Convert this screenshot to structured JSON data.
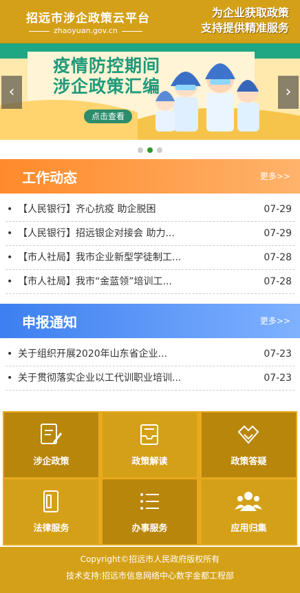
{
  "header": {
    "site_title": "招远市涉企政策云平台",
    "domain": "zhaoyuan.gov.cn",
    "slogan_line1": "为企业获取政策",
    "slogan_line2": "支持提供精准服务"
  },
  "banner": {
    "title_line1": "疫情防控期间",
    "title_line2": "涉企政策汇编",
    "button_label": "点击查看",
    "prev_label": "‹",
    "next_label": "›",
    "active_slide": 2,
    "slide_count": 3
  },
  "work_news": {
    "title": "工作动态",
    "more": "更多>>",
    "items": [
      {
        "title": "【人民银行】齐心抗疫 助企脱困",
        "date": "07-29"
      },
      {
        "title": "【人民银行】招远银企对接会 助力...",
        "date": "07-29"
      },
      {
        "title": "【市人社局】我市企业新型学徒制工...",
        "date": "07-28"
      },
      {
        "title": "【市人社局】我市“金蓝领”培训工...",
        "date": "07-28"
      }
    ]
  },
  "notices": {
    "title": "申报通知",
    "more": "更多>>",
    "items": [
      {
        "title": "关于组织开展2020年山东省企业...",
        "date": "07-23"
      },
      {
        "title": "关于贯彻落实企业以工代训职业培训...",
        "date": "07-23"
      }
    ]
  },
  "tiles": [
    {
      "label": "涉企政策",
      "icon": "policy-edit-icon",
      "color": "#b8860b"
    },
    {
      "label": "政策解读",
      "icon": "inbox-tray-icon",
      "color": "#d4a017"
    },
    {
      "label": "政策答疑",
      "icon": "handshake-icon",
      "color": "#b8860b"
    },
    {
      "label": "法律服务",
      "icon": "legal-document-icon",
      "color": "#d4a017"
    },
    {
      "label": "办事服务",
      "icon": "list-icon",
      "color": "#b8860b"
    },
    {
      "label": "应用归集",
      "icon": "group-users-icon",
      "color": "#d4a017"
    }
  ],
  "footer": {
    "copyright": "Copyright©招远市人民政府版权所有",
    "support": "技术支持:招远市信息网络中心数字金都工程部"
  }
}
